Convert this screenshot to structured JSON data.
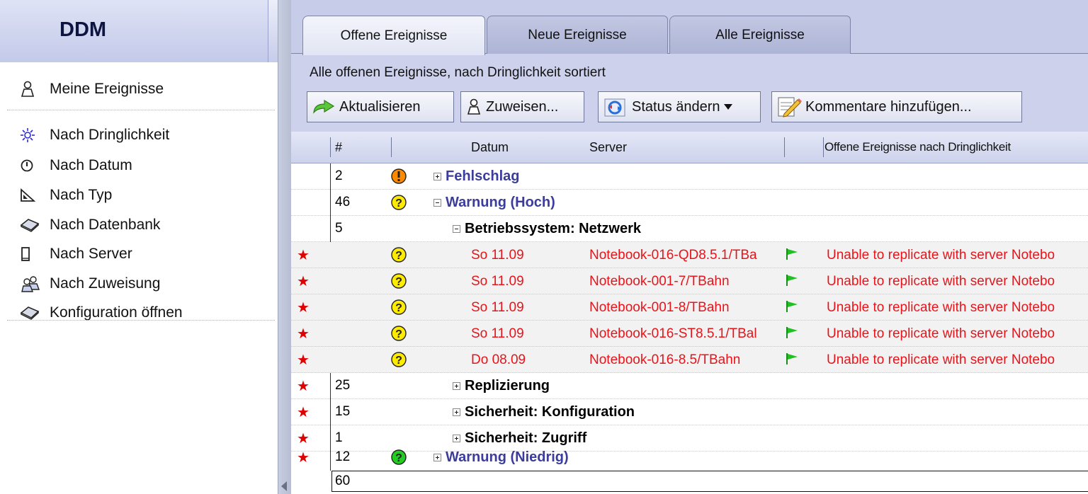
{
  "nav": {
    "title": "DDM",
    "items": [
      {
        "label": "Meine Ereignisse",
        "icon": "person-icon"
      },
      {
        "label": "Nach Dringlichkeit",
        "icon": "sun-icon"
      },
      {
        "label": "Nach Datum",
        "icon": "clock-icon"
      },
      {
        "label": "Nach Typ",
        "icon": "triangle-ruler-icon"
      },
      {
        "label": "Nach Datenbank",
        "icon": "database-book-icon"
      },
      {
        "label": "Nach Server",
        "icon": "server-tower-icon"
      },
      {
        "label": "Nach Zuweisung",
        "icon": "people-icon"
      },
      {
        "label": "Konfiguration öffnen",
        "icon": "database-book-icon"
      }
    ]
  },
  "tabs": [
    {
      "label": "Offene Ereignisse",
      "active": true
    },
    {
      "label": "Neue Ereignisse",
      "active": false
    },
    {
      "label": "Alle Ereignisse",
      "active": false
    }
  ],
  "view": {
    "caption": "Alle offenen Ereignisse, nach Dringlichkeit sortiert"
  },
  "toolbar": {
    "refresh_label": "Aktualisieren",
    "assign_label": "Zuweisen...",
    "status_label": "Status ändern",
    "comment_label": "Kommentare hinzufügen..."
  },
  "columns": {
    "count": "#",
    "date": "Datum",
    "server": "Server",
    "category": "Offene Ereignisse nach Dringlichkeit"
  },
  "rows": [
    {
      "kind": "group",
      "count": "2",
      "severity": "failure",
      "label": "Fehlschlag",
      "expanded": false,
      "starred": false
    },
    {
      "kind": "group",
      "count": "46",
      "severity": "warning-high",
      "label": "Warnung (Hoch)",
      "expanded": true,
      "starred": false
    },
    {
      "kind": "subgroup",
      "count": "5",
      "label": "Betriebssystem: Netzwerk",
      "expanded": true,
      "starred": false
    },
    {
      "kind": "detail",
      "date": "So 11.09",
      "server": "Notebook-016-QD8.5.1/TBa",
      "message": "Unable to replicate with server Notebo",
      "starred": true
    },
    {
      "kind": "detail",
      "date": "So 11.09",
      "server": "Notebook-001-7/TBahn",
      "message": "Unable to replicate with server Notebo",
      "starred": true
    },
    {
      "kind": "detail",
      "date": "So 11.09",
      "server": "Notebook-001-8/TBahn",
      "message": "Unable to replicate with server Notebo",
      "starred": true
    },
    {
      "kind": "detail",
      "date": "So 11.09",
      "server": "Notebook-016-ST8.5.1/TBal",
      "message": "Unable to replicate with server Notebo",
      "starred": true
    },
    {
      "kind": "detail",
      "date": "Do 08.09",
      "server": "Notebook-016-8.5/TBahn",
      "message": "Unable to replicate with server Notebo",
      "starred": true
    },
    {
      "kind": "subgroup",
      "count": "25",
      "label": "Replizierung",
      "expanded": false,
      "starred": true
    },
    {
      "kind": "subgroup",
      "count": "15",
      "label": "Sicherheit: Konfiguration",
      "expanded": false,
      "starred": true
    },
    {
      "kind": "subgroup",
      "count": "1",
      "label": "Sicherheit: Zugriff",
      "expanded": false,
      "starred": true
    },
    {
      "kind": "group",
      "count": "12",
      "severity": "warning-low",
      "label": "Warnung (Niedrig)",
      "expanded": false,
      "starred": true
    }
  ],
  "total": "60",
  "colors": {
    "accent_text": "#3b3c9b",
    "detail_text": "#e8141a",
    "star": "#e00000",
    "failure": "#ff8a00",
    "warning_high": "#ffeb00",
    "warning_low": "#22cc22"
  }
}
